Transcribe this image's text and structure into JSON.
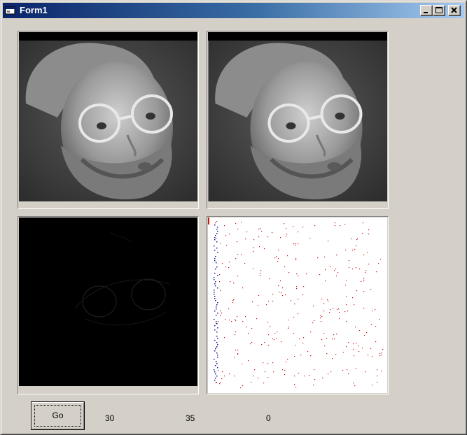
{
  "window": {
    "title": "Form1"
  },
  "caption_buttons": {
    "minimize_icon": "minimize-icon",
    "maximize_icon": "maximize-icon",
    "close_icon": "close-icon"
  },
  "images": {
    "top_left": "grayscale face photo",
    "top_right": "grayscale face photo",
    "bottom_left": "edge detection output (black)",
    "bottom_right": "scatter of colored pixels on white"
  },
  "go_button": {
    "label": "Go"
  },
  "labels": {
    "value1": "30",
    "value2": "35",
    "value3": "0"
  }
}
